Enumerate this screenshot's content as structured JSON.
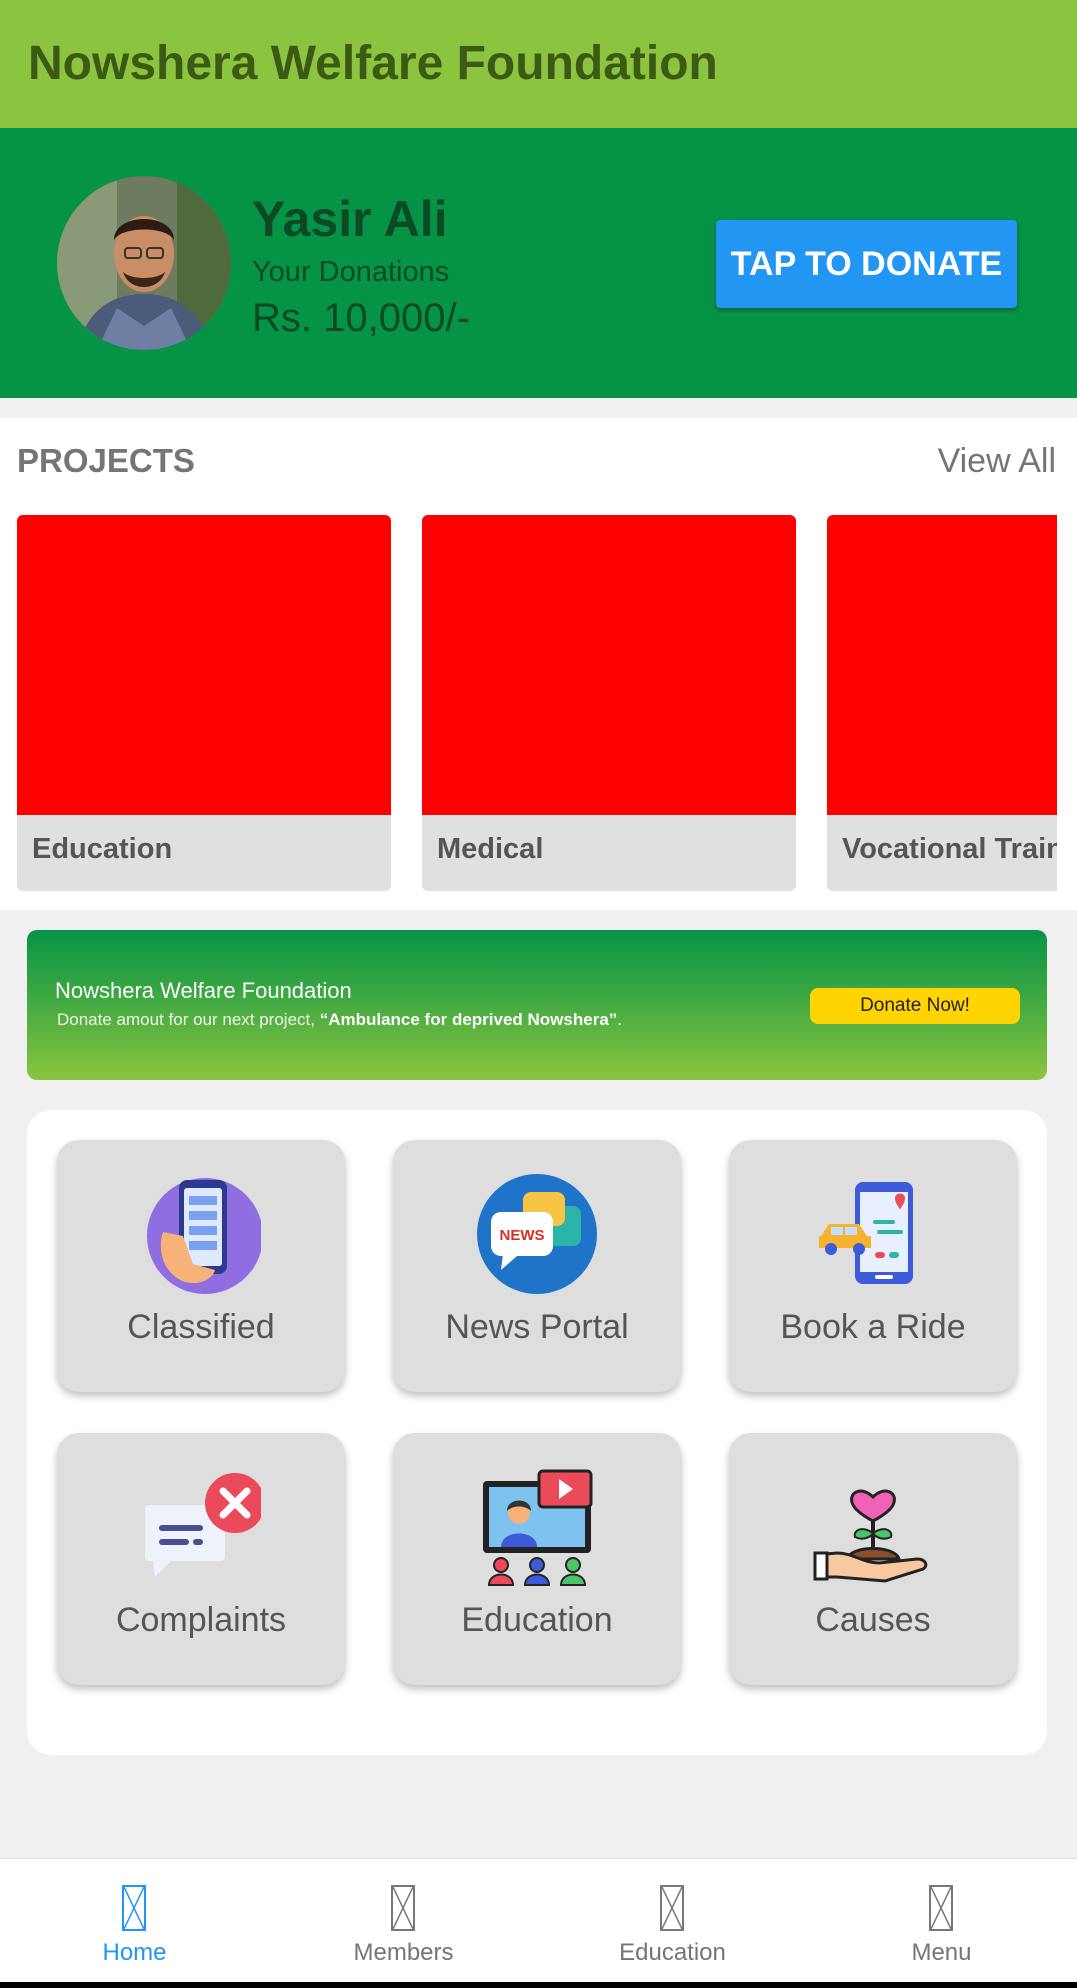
{
  "app_bar": {
    "title": "Nowshera Welfare Foundation"
  },
  "profile": {
    "name": "Yasir Ali",
    "donations_label": "Your Donations",
    "donations_amount": "Rs. 10,000/-",
    "donate_button": "TAP TO DONATE"
  },
  "projects": {
    "heading": "PROJECTS",
    "view_all": "View All",
    "items": [
      {
        "label": "Education"
      },
      {
        "label": "Medical"
      },
      {
        "label": "Vocational Training"
      }
    ]
  },
  "banner": {
    "title": "Nowshera Welfare Foundation",
    "text_prefix": "Donate amout for our next project, ",
    "text_highlight": "“Ambulance for deprived Nowshera”",
    "text_suffix": ".",
    "button": "Donate Now!"
  },
  "services": [
    {
      "label": "Classified",
      "icon": "classified-phone-icon"
    },
    {
      "label": "News Portal",
      "icon": "news-icon"
    },
    {
      "label": "Book a Ride",
      "icon": "ride-car-icon"
    },
    {
      "label": "Complaints",
      "icon": "complaints-icon"
    },
    {
      "label": "Education",
      "icon": "video-education-icon"
    },
    {
      "label": "Causes",
      "icon": "heart-plant-hand-icon"
    }
  ],
  "bottom_nav": {
    "items": [
      {
        "label": "Home",
        "active": true
      },
      {
        "label": "Members",
        "active": false
      },
      {
        "label": "Education",
        "active": false
      },
      {
        "label": "Menu",
        "active": false
      }
    ]
  },
  "colors": {
    "app_bar": "#8bc540",
    "profile_bg": "#059446",
    "donate_button": "#2196f3",
    "project_placeholder": "#ff0000",
    "banner_button": "#ffd400",
    "nav_active": "#2196f3"
  }
}
